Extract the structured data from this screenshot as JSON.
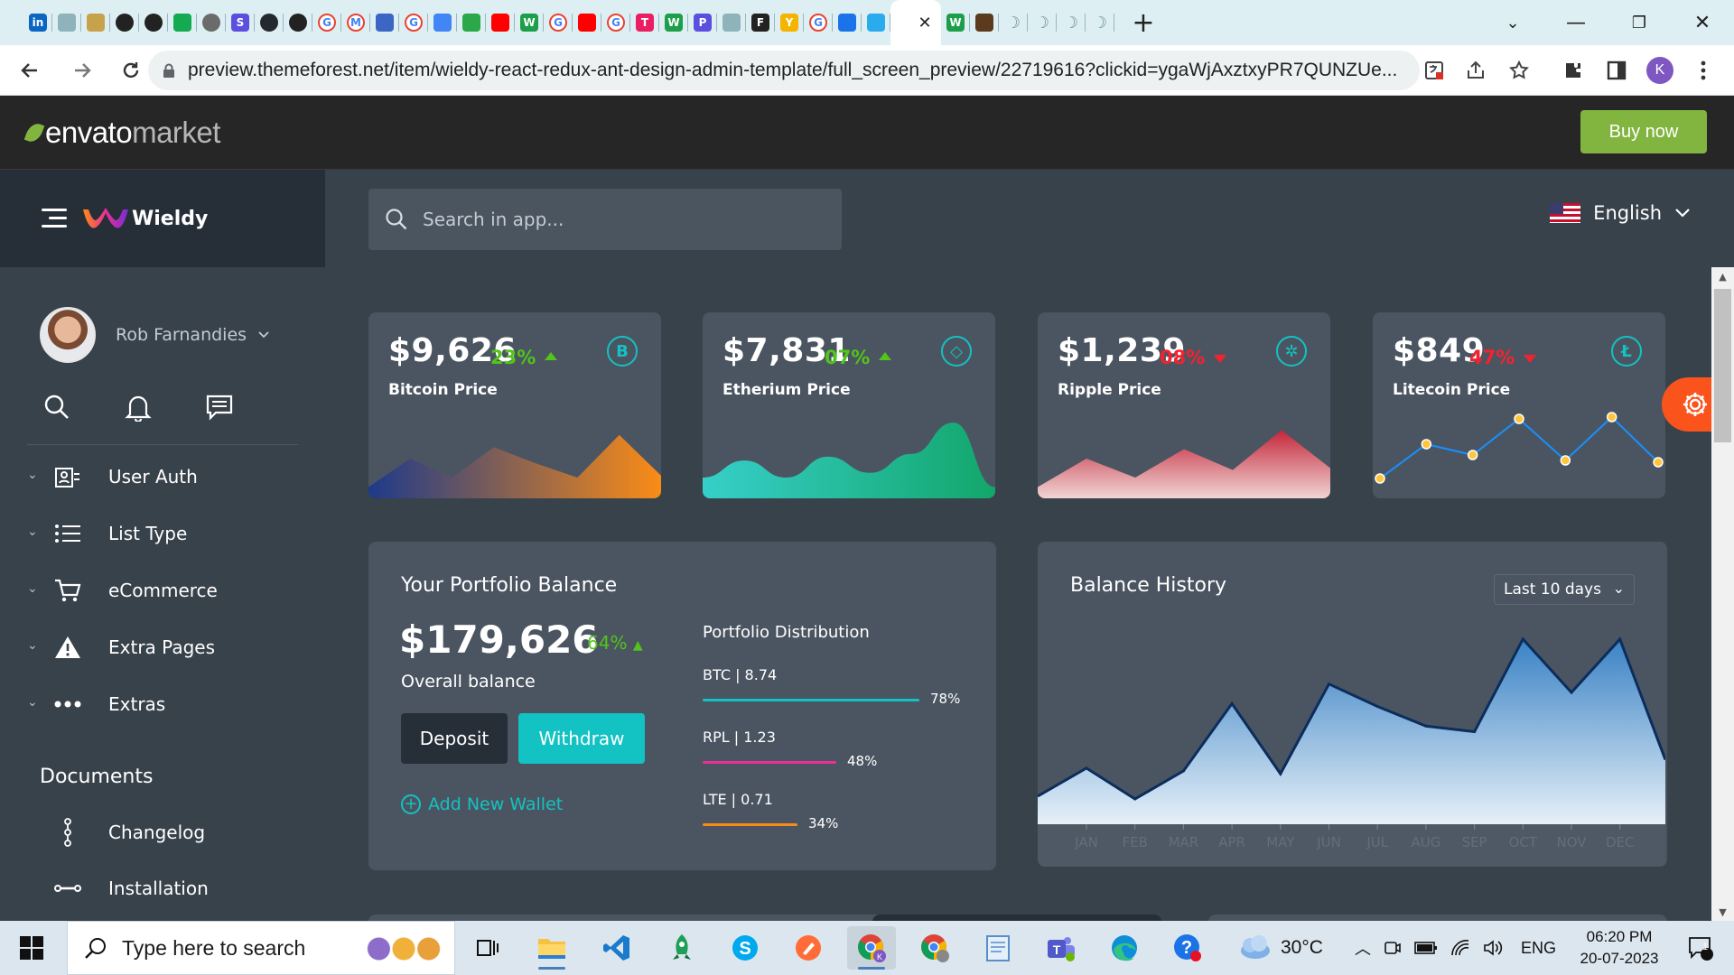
{
  "browser": {
    "tab_icons": [
      "linkedin",
      "app",
      "pin",
      "globe",
      "globe",
      "mongo",
      "openai",
      "s-app",
      "github",
      "react",
      "google",
      "gmail",
      "print",
      "google",
      "translate",
      "ms",
      "youtube",
      "w",
      "google",
      "youtube",
      "google",
      "t",
      "w",
      "p",
      "app",
      "f",
      "y",
      "google",
      "meet",
      "send",
      "active",
      "w",
      "image",
      "moon",
      "moon",
      "moon",
      "moon"
    ],
    "url": "preview.themeforest.net/item/wieldy-react-redux-ant-design-admin-template/full_screen_preview/22719616?clickid=ygaWjAxztxyPR7QUNZUe...",
    "profile_initial": "K"
  },
  "envato": {
    "logo_word1": "envato",
    "logo_word2": "market",
    "buy_label": "Buy now"
  },
  "app": {
    "brand": "Wieldy",
    "search_placeholder": "Search in app...",
    "language": "English"
  },
  "sidebar": {
    "user_name": "Rob Farnandies",
    "items": [
      {
        "label": "User Auth",
        "icon": "user-auth-icon"
      },
      {
        "label": "List Type",
        "icon": "list-icon"
      },
      {
        "label": "eCommerce",
        "icon": "cart-icon"
      },
      {
        "label": "Extra Pages",
        "icon": "warning-icon"
      },
      {
        "label": "Extras",
        "icon": "ellipsis-icon"
      }
    ],
    "documents_title": "Documents",
    "docs": [
      {
        "label": "Changelog",
        "icon": "timeline-icon"
      },
      {
        "label": "Installation",
        "icon": "installation-icon"
      }
    ]
  },
  "prices": [
    {
      "price": "$9,626",
      "pct": "23%",
      "dir": "up",
      "label": "Bitcoin Price",
      "coin_symbol": "B",
      "colors": [
        "#1E3A8A",
        "#FA8C16"
      ],
      "spark": [
        10,
        40,
        20,
        52,
        35,
        20,
        65,
        22
      ]
    },
    {
      "price": "$7,831",
      "pct": "07%",
      "dir": "up",
      "label": "Etherium Price",
      "coin_symbol": "◇",
      "colors": [
        "#36CFC9",
        "#13A66B"
      ],
      "spark": [
        20,
        38,
        20,
        42,
        25,
        45,
        78,
        10
      ]
    },
    {
      "price": "$1,239",
      "pct": "08%",
      "dir": "down",
      "label": "Ripple Price",
      "coin_symbol": "✲",
      "colors": [
        "#F0D4D4",
        "#C4273A"
      ],
      "spark": [
        10,
        40,
        20,
        50,
        28,
        70,
        30
      ]
    },
    {
      "price": "$849",
      "pct": "47%",
      "dir": "down",
      "label": "Litecoin Price",
      "coin_symbol": "Ł",
      "colors": [
        "#FFC53D",
        "#1890FF"
      ],
      "spark": [
        12,
        50,
        38,
        78,
        32,
        80,
        30
      ]
    }
  ],
  "portfolio": {
    "title": "Your Portfolio Balance",
    "amount": "$179,626",
    "pct": "64%",
    "subtitle": "Overall balance",
    "deposit_label": "Deposit",
    "withdraw_label": "Withdraw",
    "add_wallet_label": "Add New Wallet",
    "dist_title": "Portfolio Distribution",
    "distribution": [
      {
        "label": "BTC | 8.74",
        "pct": "78%",
        "value": 0.78,
        "color": "#13C2C2"
      },
      {
        "label": "RPL | 1.23",
        "pct": "48%",
        "value": 0.48,
        "color": "#EB2F96"
      },
      {
        "label": "LTE | 0.71",
        "pct": "34%",
        "value": 0.34,
        "color": "#FA8C16"
      }
    ]
  },
  "balance_history": {
    "title": "Balance History",
    "range": "Last 10 days"
  },
  "chart_data": {
    "type": "area",
    "categories": [
      "JAN",
      "FEB",
      "MAR",
      "APR",
      "MAY",
      "JUN",
      "JUL",
      "AUG",
      "SEP",
      "OCT",
      "NOV",
      "DEC"
    ],
    "series": [
      {
        "values": [
          2000,
          900,
          1900,
          4300,
          1800,
          5000,
          4200,
          3500,
          3300,
          6600,
          4700,
          6600
        ]
      }
    ],
    "first_value": 1000,
    "last_value": 2300,
    "ylim": [
      0,
      7500
    ],
    "grid": false
  },
  "taskbar": {
    "search_placeholder": "Type here to search",
    "weather": "30°C",
    "language": "ENG",
    "time": "06:20 PM",
    "date": "20-07-2023",
    "notification_count": "1"
  }
}
